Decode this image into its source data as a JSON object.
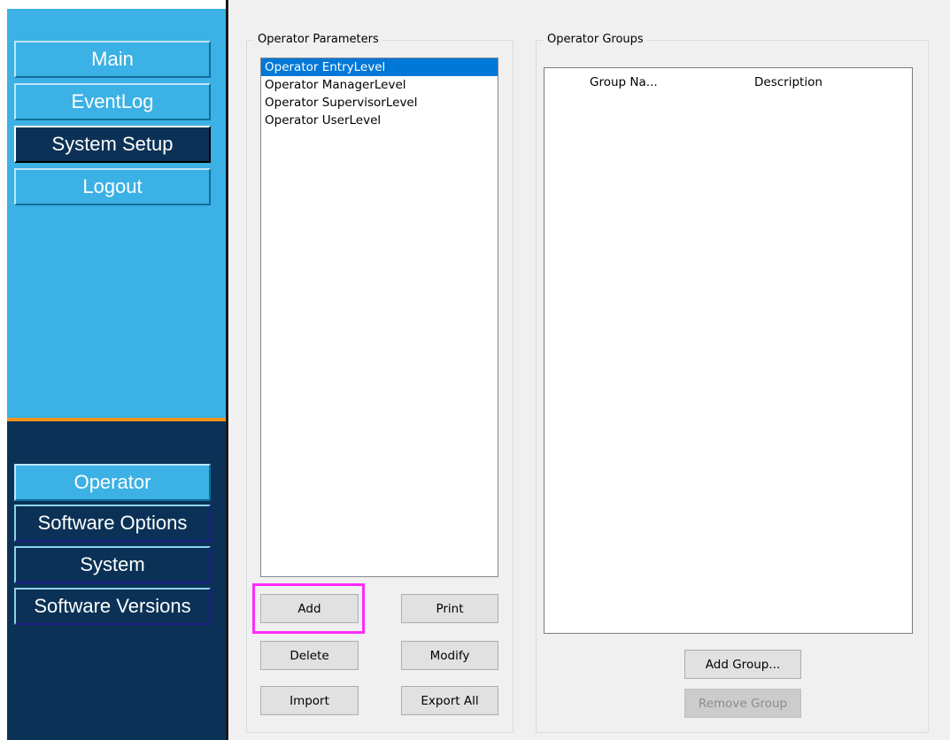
{
  "nav": {
    "main": "Main",
    "eventlog": "EventLog",
    "system_setup": "System Setup",
    "logout": "Logout"
  },
  "subnav": {
    "operator": "Operator",
    "software_options": "Software Options",
    "system": "System",
    "software_versions": "Software Versions"
  },
  "operator_parameters": {
    "title": "Operator Parameters",
    "items": [
      "Operator EntryLevel",
      "Operator ManagerLevel",
      "Operator SupervisorLevel",
      "Operator UserLevel"
    ],
    "selected_index": 0,
    "buttons": {
      "add": "Add",
      "print": "Print",
      "delete": "Delete",
      "modify": "Modify",
      "import": "Import",
      "export_all": "Export All"
    }
  },
  "operator_groups": {
    "title": "Operator Groups",
    "columns": [
      "Group Na...",
      "Description"
    ],
    "buttons": {
      "add_group": "Add Group...",
      "remove_group": "Remove Group"
    }
  },
  "colors": {
    "nav_light": "#3bb1e5",
    "nav_dark": "#0b3256",
    "separator": "#f7941d",
    "highlight": "#ff2bff",
    "selection": "#0078d7"
  }
}
